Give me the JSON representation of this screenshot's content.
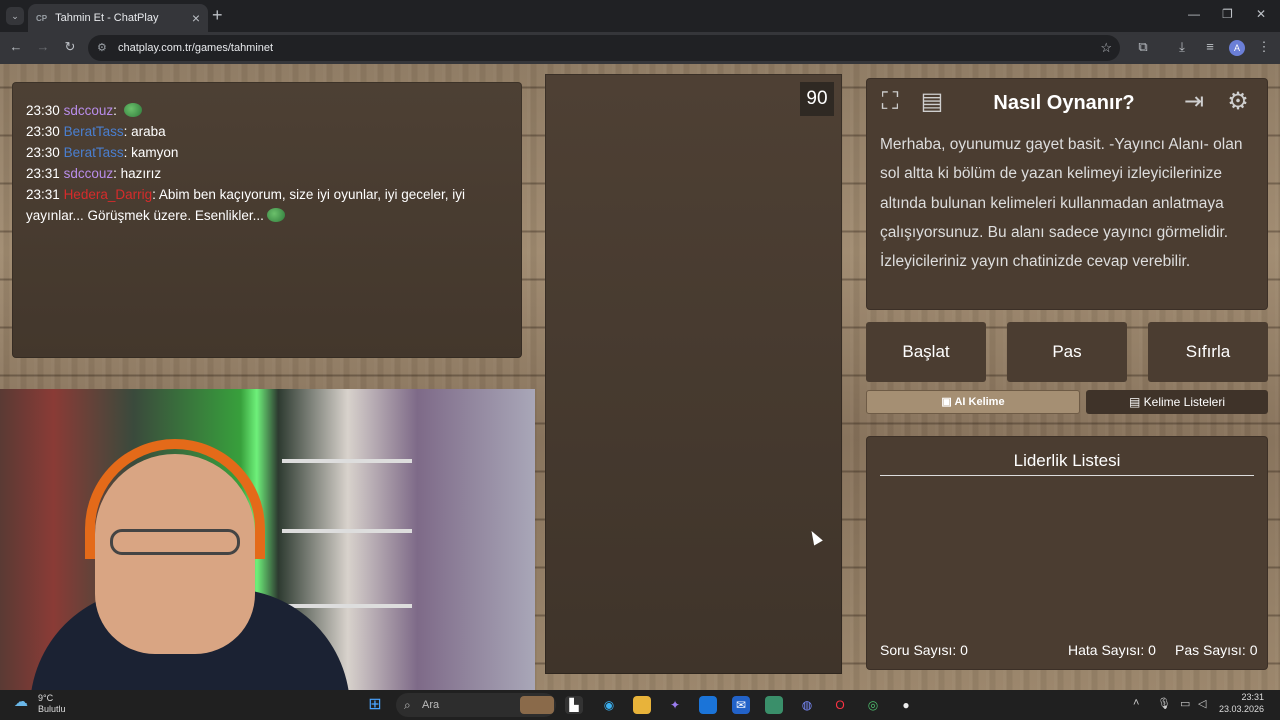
{
  "browser": {
    "tab_title": "Tahmin Et - ChatPlay",
    "tab_favicon": "CP",
    "url": "chatplay.com.tr/games/tahminet",
    "profile_initial": "A"
  },
  "chat": {
    "messages": [
      {
        "time": "23:30",
        "user": "sdccouz",
        "user_color": "purple",
        "text": "",
        "emote": true
      },
      {
        "time": "23:30",
        "user": "BeratTass",
        "user_color": "blue",
        "text": "araba",
        "emote": false
      },
      {
        "time": "23:30",
        "user": "BeratTass",
        "user_color": "blue",
        "text": "kamyon",
        "emote": false
      },
      {
        "time": "23:31",
        "user": "sdccouz",
        "user_color": "purple",
        "text": "hazırız",
        "emote": false
      },
      {
        "time": "23:31",
        "user": "Hedera_Darrig",
        "user_color": "red",
        "text": "Abim ben kaçıyorum, size iyi oyunlar, iyi geceler, iyi yayınlar... Görüşmek üzere. Esenlikler...",
        "emote": true
      }
    ]
  },
  "game": {
    "timer": "90",
    "info_title": "Nasıl Oynanır?",
    "info_text": "Merhaba, oyunumuz gayet basit. -Yayıncı Alanı- olan sol altta ki bölüm de yazan kelimeyi izleyicilerinize altında bulunan kelimeleri kullanmadan anlatmaya çalışıyorsunuz. Bu alanı sadece yayıncı görmelidir. İzleyicileriniz yayın chatinizde cevap verebilir.",
    "buttons": {
      "start": "Başlat",
      "pass": "Pas",
      "reset": "Sıfırla"
    },
    "ai_word_label": "AI Kelime",
    "word_lists_label": "Kelime Listeleri",
    "leaderboard_title": "Liderlik Listesi",
    "stats": {
      "questions": "Soru Sayısı: 0",
      "errors": "Hata Sayısı: 0",
      "passes": "Pas Sayısı: 0"
    }
  },
  "taskbar": {
    "weather_temp": "9°C",
    "weather_desc": "Bulutlu",
    "search_placeholder": "Ara",
    "time": "23:31",
    "date": "23.03.2026"
  }
}
